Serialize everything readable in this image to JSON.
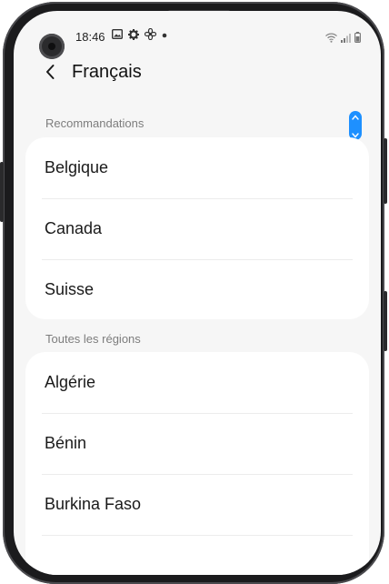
{
  "status_bar": {
    "time": "18:46",
    "icons": [
      "image-icon",
      "gear-icon",
      "fan-icon",
      "dot-icon"
    ],
    "right_icons": [
      "wifi-icon",
      "signal-icon",
      "battery-icon"
    ]
  },
  "app_bar": {
    "title": "Français",
    "back_icon": "chevron-left-icon"
  },
  "sections": {
    "recommendations": {
      "header": "Recommandations",
      "items": [
        "Belgique",
        "Canada",
        "Suisse"
      ]
    },
    "all_regions": {
      "header": "Toutes les régions",
      "items": [
        "Algérie",
        "Bénin",
        "Burkina Faso"
      ]
    }
  },
  "colors": {
    "background": "#f6f6f6",
    "card": "#ffffff",
    "accent": "#1e90ff"
  }
}
